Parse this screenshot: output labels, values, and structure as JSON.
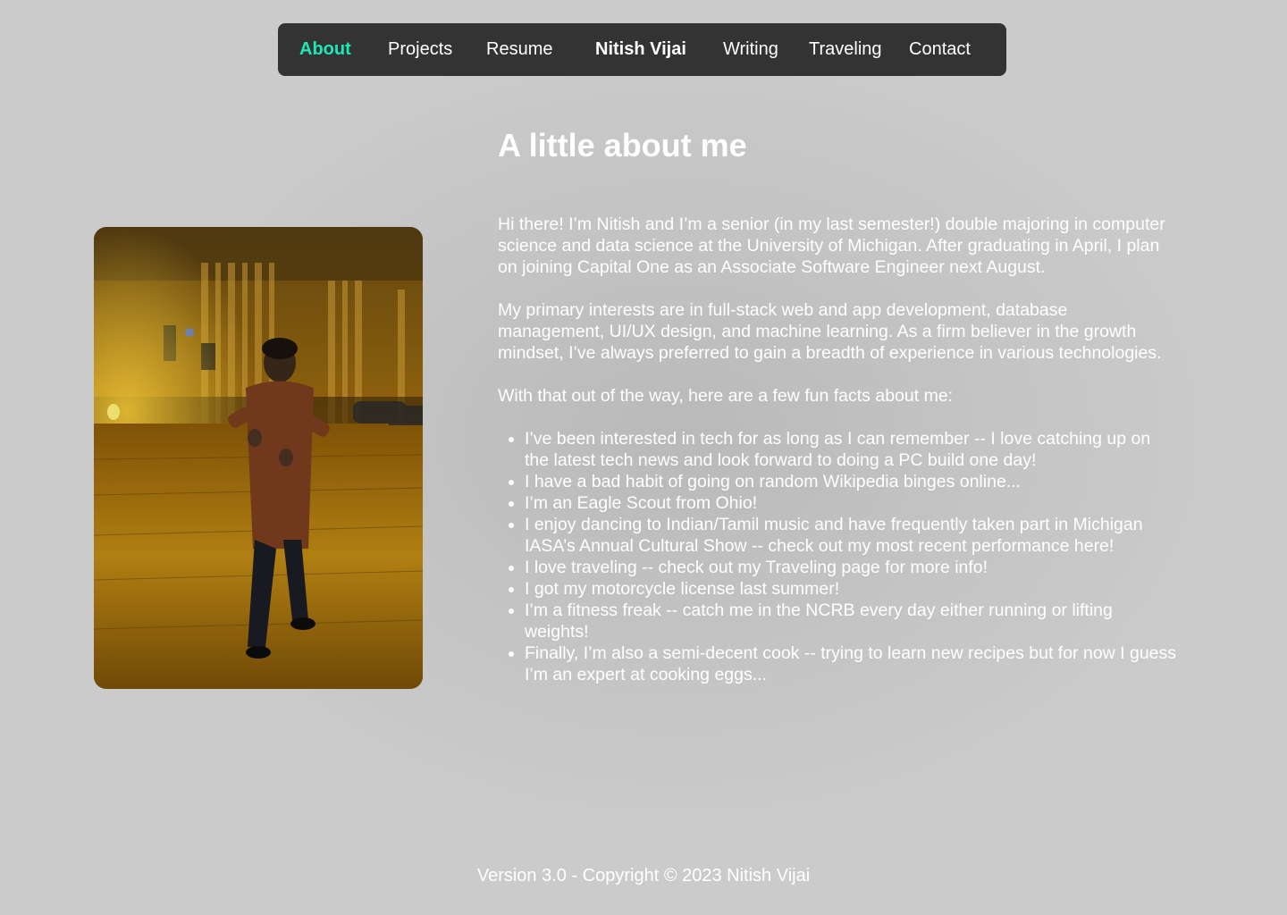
{
  "nav": {
    "items": [
      {
        "key": "about",
        "label": "About",
        "active": true
      },
      {
        "key": "projects",
        "label": "Projects"
      },
      {
        "key": "resume",
        "label": "Resume"
      },
      {
        "key": "brand",
        "label": "Nitish Vijai"
      },
      {
        "key": "writing",
        "label": "Writing"
      },
      {
        "key": "traveling",
        "label": "Traveling"
      },
      {
        "key": "contact",
        "label": "Contact"
      }
    ],
    "active_color": "#1de9b6",
    "background_color": "#333333"
  },
  "about": {
    "heading": "A little about me",
    "paragraphs": [
      "Hi there! I’m Nitish and I’m a senior (in my last semester!) double majoring in computer science and data science at the University of Michigan. After graduating in April, I plan on joining Capital One as an Associate Software Engineer next August.",
      "My primary interests are in full-stack web and app development, database management, UI/UX design, and machine learning. As a firm believer in the growth mindset, I’ve always preferred to gain a breadth of experience in various technologies.",
      "With that out of the way, here are a few fun facts about me:"
    ],
    "fun_facts": [
      "I’ve been interested in tech for as long as I can remember -- I love catching up on the latest tech news and look forward to doing a PC build one day!",
      "I have a bad habit of going on random Wikipedia binges online...",
      "I’m an Eagle Scout from Ohio!",
      "I enjoy dancing to Indian/Tamil music and have frequently taken part in Michigan IASA’s Annual Cultural Show -- check out my most recent performance here!",
      "I love traveling -- check out my Traveling page for more info!",
      "I got my motorcycle license last summer!",
      "I’m a fitness freak -- catch me in the NCRB every day either running or lifting weights!",
      "Finally, I’m also a semi-decent cook -- trying to learn new recipes but for now I guess I’m an expert at cooking eggs..."
    ]
  },
  "footer": {
    "text": "Version 3.0 - Copyright © 2023 Nitish Vijai"
  }
}
